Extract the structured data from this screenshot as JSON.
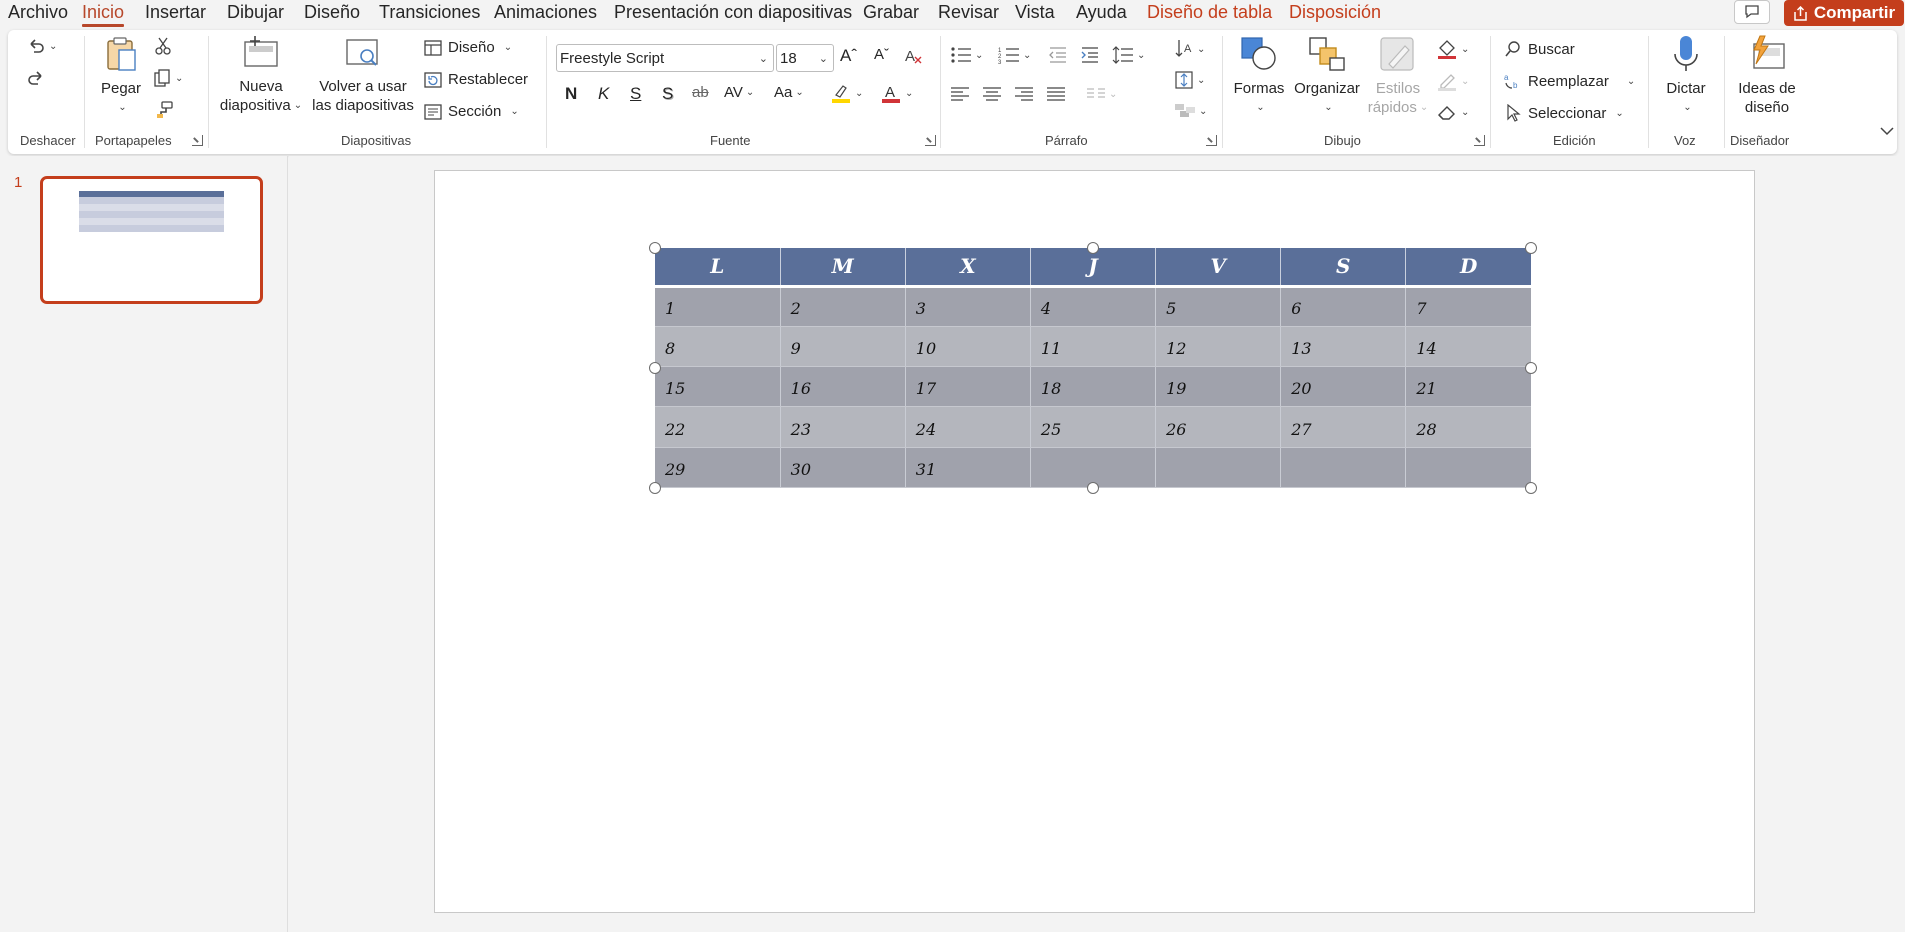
{
  "menu_tabs": [
    {
      "label": "Archivo"
    },
    {
      "label": "Inicio"
    },
    {
      "label": "Insertar"
    },
    {
      "label": "Dibujar"
    },
    {
      "label": "Diseño"
    },
    {
      "label": "Transiciones"
    },
    {
      "label": "Animaciones"
    },
    {
      "label": "Presentación con diapositivas"
    },
    {
      "label": "Grabar"
    },
    {
      "label": "Revisar"
    },
    {
      "label": "Vista"
    },
    {
      "label": "Ayuda"
    },
    {
      "label": "Diseño de tabla"
    },
    {
      "label": "Disposición"
    }
  ],
  "active_tab": "Inicio",
  "share_label": "Compartir",
  "colors": {
    "accent": "#c43e1c",
    "table_header": "#5a6f99",
    "row_dark": "#a0a2ac",
    "row_light": "#b4b6bd",
    "highlight": "#ffd700",
    "font_color": "#d13438"
  },
  "ribbon": {
    "groups": {
      "deshacer": "Deshacer",
      "portapapeles": "Portapapeles",
      "diapositivas": "Diapositivas",
      "fuente": "Fuente",
      "parrafo": "Párrafo",
      "dibujo": "Dibujo",
      "edicion": "Edición",
      "voz": "Voz",
      "disenador": "Diseñador"
    },
    "pegar": "Pegar",
    "nueva_diapositiva": [
      "Nueva",
      "diapositiva"
    ],
    "volver_usar": [
      "Volver a usar",
      "las diapositivas"
    ],
    "diseno": "Diseño",
    "restablecer": "Restablecer",
    "seccion": "Sección",
    "font_name": "Freestyle Script",
    "font_size": "18",
    "bold": "N",
    "italic": "K",
    "underline": "S",
    "shadow": "S",
    "strike": "ab",
    "spacing": "AV",
    "case": "Aa",
    "formas": "Formas",
    "organizar": "Organizar",
    "estilos": [
      "Estilos",
      "rápidos"
    ],
    "buscar": "Buscar",
    "reemplazar": "Reemplazar",
    "seleccionar": "Seleccionar",
    "dictar": "Dictar",
    "ideas": [
      "Ideas de",
      "diseño"
    ]
  },
  "slide_pane": {
    "slide_number": "1"
  },
  "calendar": {
    "headers": [
      "L",
      "M",
      "X",
      "J",
      "V",
      "S",
      "D"
    ],
    "rows": [
      [
        "1",
        "2",
        "3",
        "4",
        "5",
        "6",
        "7"
      ],
      [
        "8",
        "9",
        "10",
        "11",
        "12",
        "13",
        "14"
      ],
      [
        "15",
        "16",
        "17",
        "18",
        "19",
        "20",
        "21"
      ],
      [
        "22",
        "23",
        "24",
        "25",
        "26",
        "27",
        "28"
      ],
      [
        "29",
        "30",
        "31",
        "",
        "",
        "",
        ""
      ]
    ]
  }
}
